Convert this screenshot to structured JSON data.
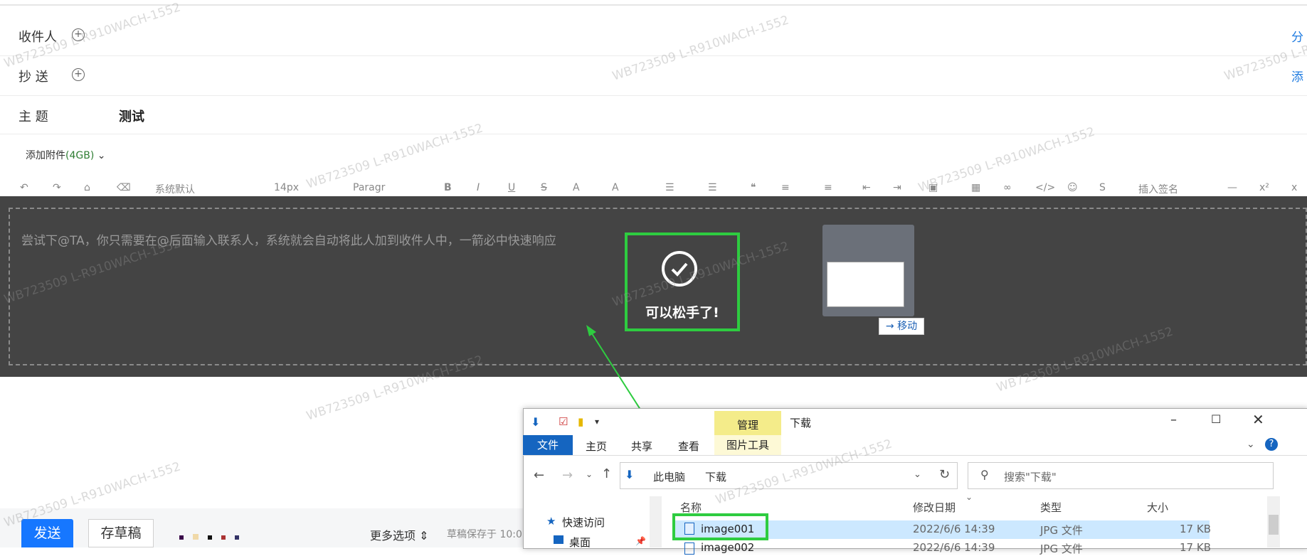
{
  "compose": {
    "to_label": "收件人",
    "cc_label": "抄  送",
    "subject_label": "主  题",
    "subject_value": "测试",
    "right_link_1": "分",
    "right_link_2": "添",
    "attach_label": "添加附件",
    "attach_size": "(4GB)",
    "placeholder": "尝试下@TA，你只需要在@后面输入联系人，系统就会自动将此人加到收件人中，一箭必中快速响应"
  },
  "toolbar": {
    "font": "系统默认",
    "size": "14px",
    "paragraph": "Paragr",
    "signature": "插入签名"
  },
  "drop": {
    "ok_text": "可以松手了!",
    "move_label": "→ 移动"
  },
  "footer": {
    "send": "发送",
    "draft": "存草稿",
    "more": "更多选项",
    "saved": "草稿保存于 10:0"
  },
  "explorer": {
    "title": "下载",
    "manage_tab": "管理",
    "picture_tools": "图片工具",
    "tabs": [
      "文件",
      "主页",
      "共享",
      "查看"
    ],
    "breadcrumb": [
      "此电脑",
      "下载"
    ],
    "search_placeholder": "搜索\"下载\"",
    "columns": [
      "名称",
      "修改日期",
      "类型",
      "大小"
    ],
    "nav": [
      "快速访问",
      "桌面"
    ],
    "files": [
      {
        "name": "image001",
        "date": "2022/6/6 14:39",
        "type": "JPG 文件",
        "size": "17 KB"
      },
      {
        "name": "image002",
        "date": "2022/6/6 14:39",
        "type": "JPG 文件",
        "size": "17 KB"
      }
    ]
  },
  "watermark": "WB723509 L-R910WACH-1552",
  "colors": {
    "accent": "#1677ff",
    "highlight": "#2ecc40",
    "overlay": "#444444"
  }
}
